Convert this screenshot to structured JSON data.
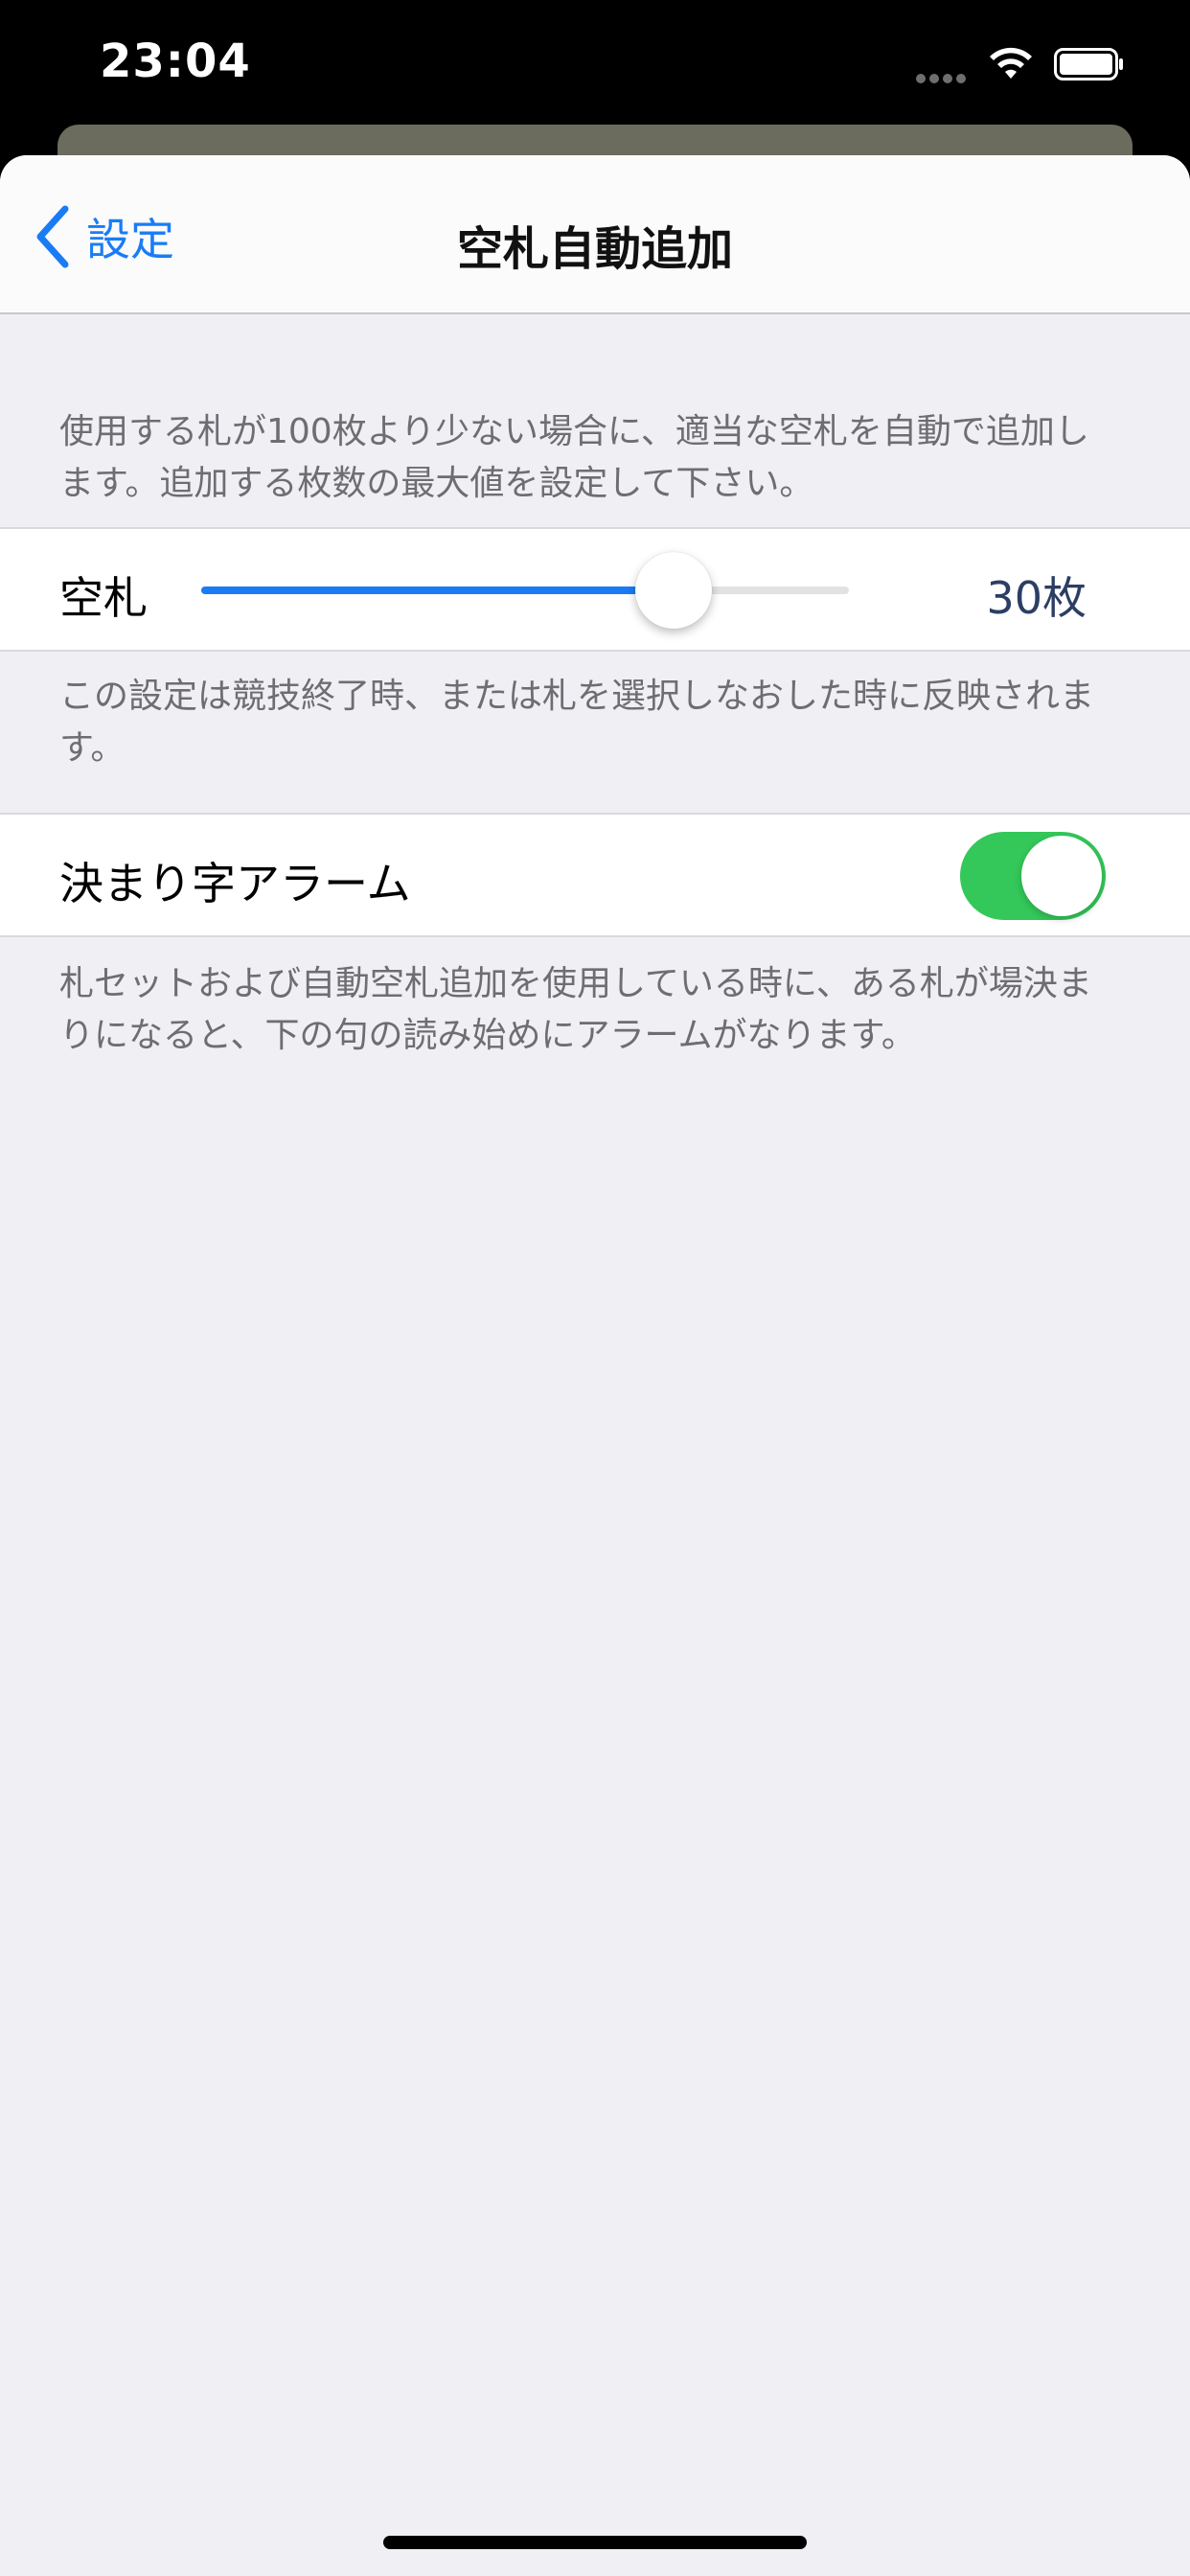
{
  "status_bar": {
    "time": "23:04"
  },
  "nav": {
    "back_label": "設定",
    "title": "空札自動追加"
  },
  "sections": {
    "slider_header": "使用する札が100枚より少ない場合に、適当な空札を自動で追加します。追加する枚数の最大値を設定して下さい。",
    "slider_cell": {
      "label": "空札",
      "value_text": "30枚",
      "value_fraction": 0.73
    },
    "slider_footer": "この設定は競技終了時、または札を選択しなおした時に反映されます。",
    "alarm_cell": {
      "label": "決まり字アラーム",
      "toggle_on": true
    },
    "alarm_footer": "札セットおよび自動空札追加を使用している時に、ある札が場決まりになると、下の句の読み始めにアラームがなります。"
  },
  "colors": {
    "accent": "#1a7cf5",
    "toggle_on": "#34c759",
    "background": "#efeff4"
  },
  "icons": {
    "back": "chevron-left-icon",
    "wifi": "wifi-icon",
    "battery": "battery-icon",
    "signal": "signal-dots-icon"
  }
}
